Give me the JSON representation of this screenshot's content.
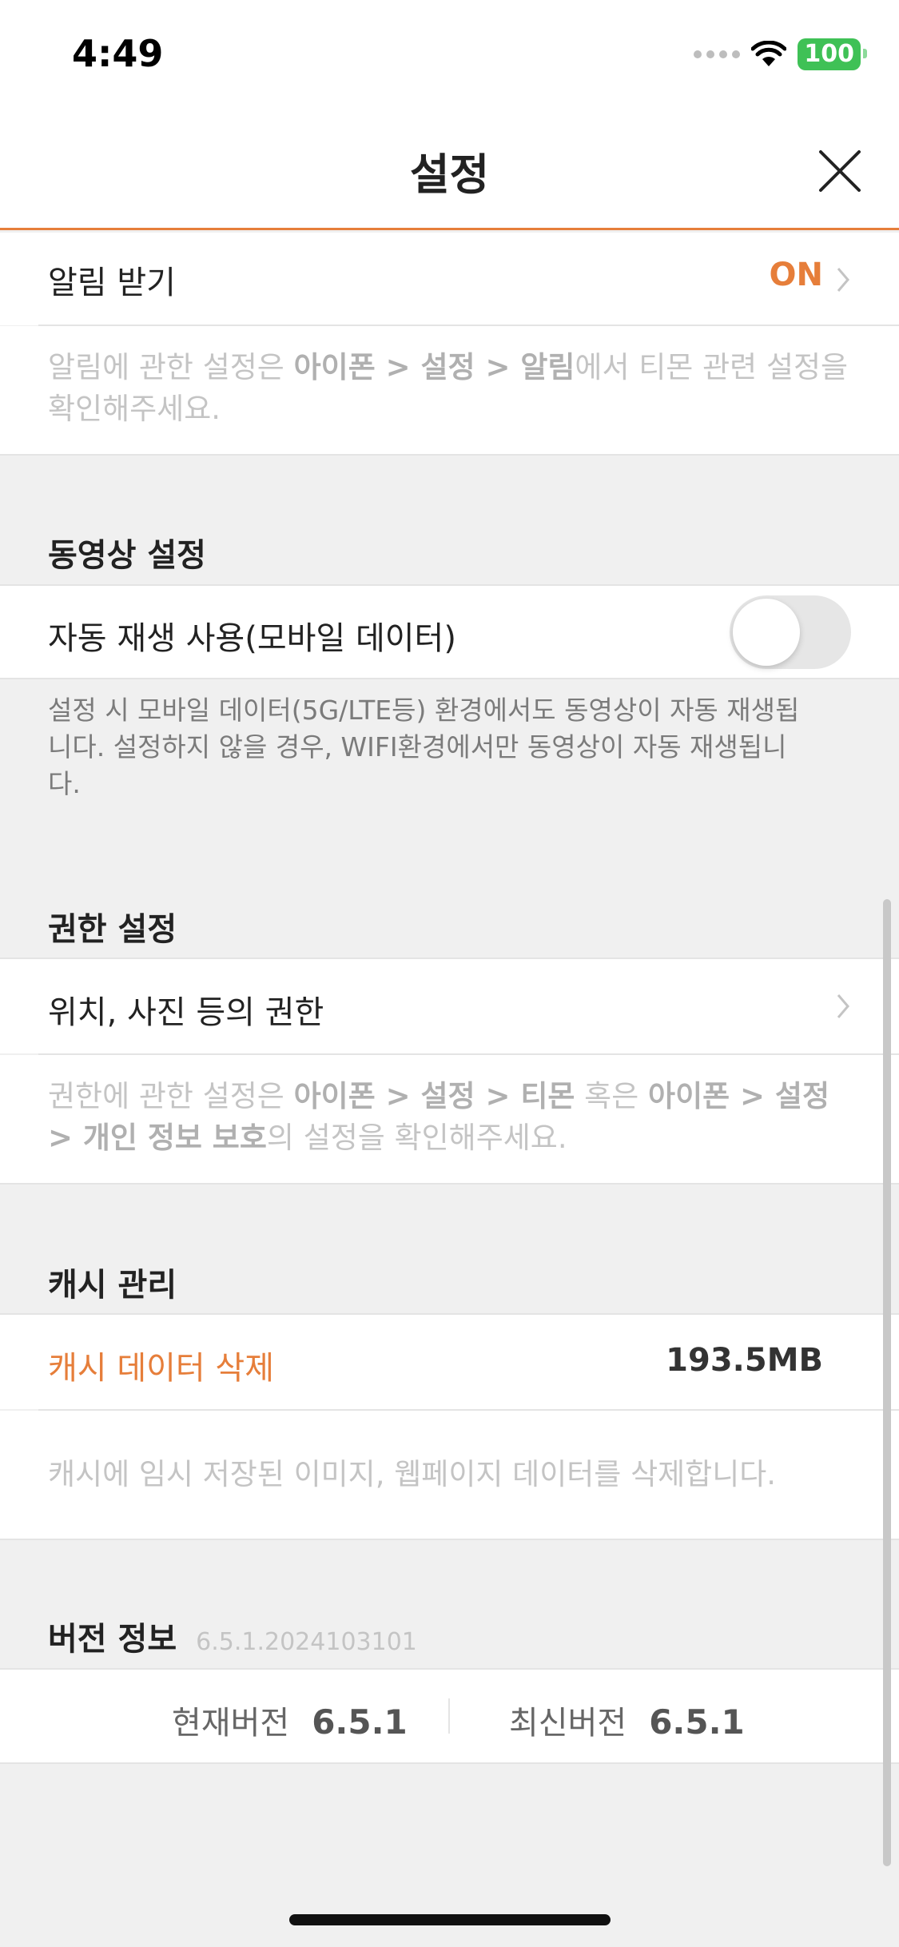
{
  "status_bar": {
    "time": "4:49",
    "battery": "100"
  },
  "header": {
    "title": "설정"
  },
  "notification": {
    "label": "알림 받기",
    "value": "ON",
    "note_parts": [
      "알림에 관한 설정은 ",
      "아이폰 > 설정 > 알림",
      "에서 티몬 관련 설정을 확인해주세요."
    ]
  },
  "video": {
    "section_title": "동영상 설정",
    "autoplay_label": "자동 재생 사용(모바일 데이터)",
    "autoplay_on": false,
    "note": "설정 시 모바일 데이터(5G/LTE등) 환경에서도 동영상이 자동 재생됩니다. 설정하지 않을 경우, WIFI환경에서만 동영상이 자동 재생됩니다."
  },
  "permission": {
    "section_title": "권한 설정",
    "row_label": "위치, 사진 등의 권한",
    "note_parts": [
      "권한에 관한 설정은 ",
      "아이폰 > 설정 > 티몬",
      " 혹은 ",
      "아이폰 > 설정 > 개인 정보 보호",
      "의 설정을 확인해주세요."
    ]
  },
  "cache": {
    "section_title": "캐시 관리",
    "delete_label": "캐시 데이터 삭제",
    "size": "193.5MB",
    "note": "캐시에 임시 저장된 이미지, 웹페이지 데이터를 삭제합니다."
  },
  "version": {
    "section_title": "버전 정보",
    "build": "6.5.1.2024103101",
    "current_label": "현재버전",
    "current_value": "6.5.1",
    "latest_label": "최신버전",
    "latest_value": "6.5.1"
  },
  "colors": {
    "accent": "#e67e3a",
    "toggle_off": "#e6e6e6",
    "battery": "#3fc156"
  }
}
